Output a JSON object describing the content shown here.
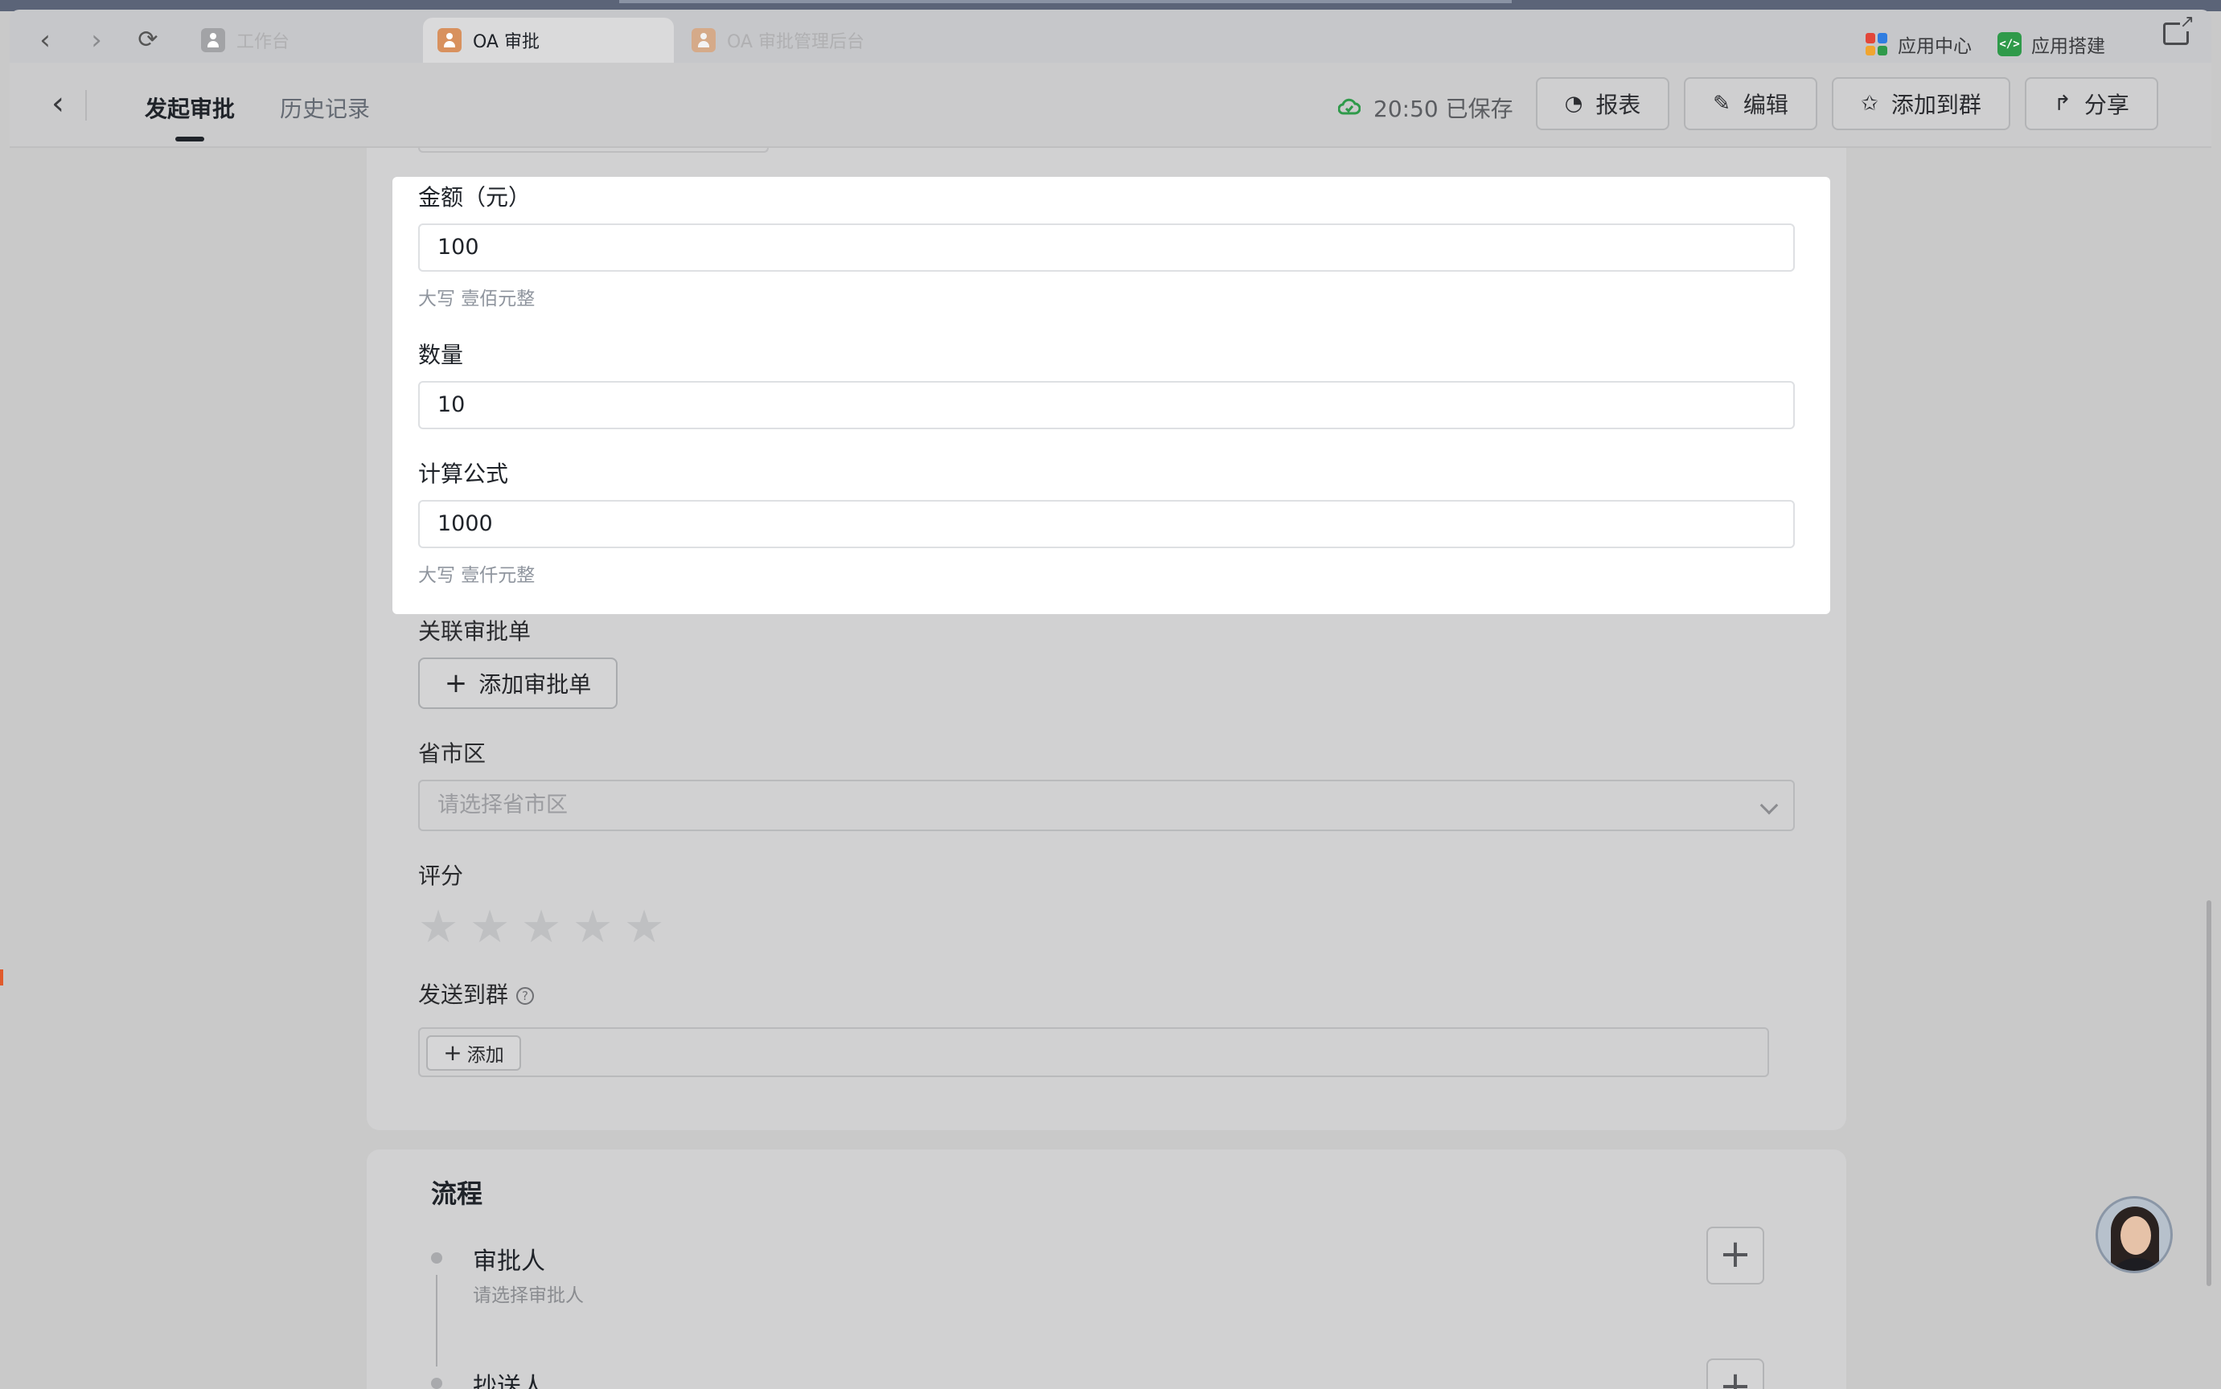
{
  "browser": {
    "tabs": [
      {
        "label": "工作台",
        "active": false
      },
      {
        "label": "OA 审批",
        "active": true
      },
      {
        "label": "OA 审批管理后台",
        "active": false
      }
    ],
    "app_center_label": "应用中心",
    "app_builder_label": "应用搭建",
    "icons": [
      "back-arrow-icon",
      "forward-arrow-icon",
      "refresh-icon",
      "open-external-icon"
    ]
  },
  "header": {
    "tabs": [
      "发起审批",
      "历史记录"
    ],
    "save_status": "20:50 已保存",
    "buttons": {
      "report": "报表",
      "edit": "编辑",
      "add_to_group": "添加到群",
      "share": "分享"
    }
  },
  "form": {
    "amount": {
      "label": "金额（元）",
      "value": "100",
      "uppercase_hint": "大写 壹佰元整"
    },
    "quantity": {
      "label": "数量",
      "value": "10"
    },
    "formula": {
      "label": "计算公式",
      "value": "1000",
      "uppercase_hint": "大写 壹仟元整"
    },
    "related": {
      "label": "关联审批单",
      "button": "添加审批单"
    },
    "region": {
      "label": "省市区",
      "placeholder": "请选择省市区"
    },
    "rating": {
      "label": "评分",
      "max": 5,
      "value": 0
    },
    "send_group": {
      "label": "发送到群",
      "button": "添加"
    }
  },
  "flow": {
    "title": "流程",
    "steps": [
      {
        "name": "审批人",
        "sub": "请选择审批人"
      },
      {
        "name": "抄送人"
      }
    ]
  },
  "colors": {
    "highlight_bg": "#ffffff",
    "overlay_bg": "#c9c9c9",
    "saved_icon": "#2f9a4a",
    "builder_icon": "#2f9a4a"
  }
}
